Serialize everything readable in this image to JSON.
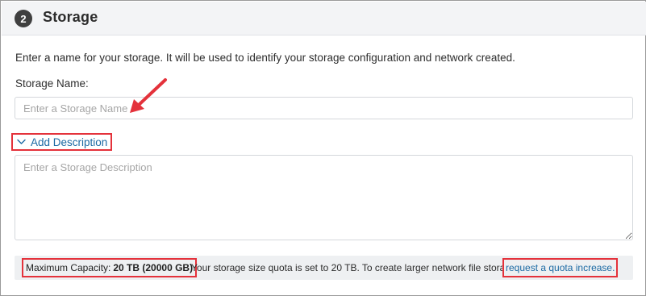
{
  "section": {
    "step_number": "2",
    "title": "Storage"
  },
  "intro_text": "Enter a name for your storage. It will be used to identify your storage configuration and network created.",
  "storage_name": {
    "label": "Storage Name:",
    "value": "",
    "placeholder": "Enter a Storage Name"
  },
  "add_description": {
    "label": "Add Description",
    "expanded": true,
    "chevron_icon": "chevron-down-icon"
  },
  "description": {
    "value": "",
    "placeholder": "Enter a Storage Description"
  },
  "capacity": {
    "label": "Maximum Capacity:",
    "value": "20 TB (20000 GB)",
    "message": "Your storage size quota is set to 20 TB. To create larger network file storage,",
    "link_label": "request a quota increase",
    "link_suffix": "."
  },
  "annotation": {
    "highlight_color": "#e4323b",
    "arrow_icon": "pointer-arrow-icon"
  },
  "colors": {
    "header_bg": "#f3f4f6",
    "link": "#1a69a3",
    "badge": "#3f3f3f",
    "capacity_bg": "#eef0f2"
  }
}
